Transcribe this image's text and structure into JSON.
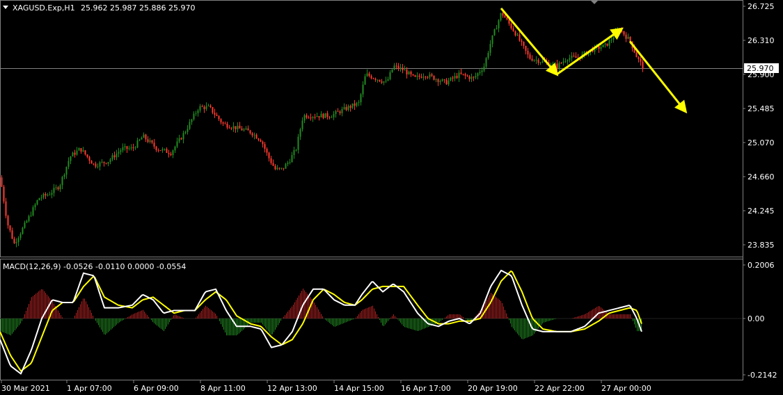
{
  "symbol_header": {
    "menu_icon": "triangle-down-icon",
    "title": "XAGUSD.Exp,H1",
    "ohlc": "25.962 25.987 25.886 25.970"
  },
  "macd_header": "MACD(12,26,9) -0.0526 -0.0110 0.0000 -0.0554",
  "price_axis": {
    "ticks": [
      "26.725",
      "26.310",
      "25.900",
      "25.485",
      "25.070",
      "24.660",
      "24.245",
      "23.835"
    ],
    "current_price": "25.970"
  },
  "macd_axis": {
    "ticks": [
      "0.2006",
      "0.00",
      "-0.2142"
    ]
  },
  "time_axis": {
    "labels": [
      "30 Mar 2021",
      "1 Apr 07:00",
      "6 Apr 09:00",
      "8 Apr 11:00",
      "12 Apr 13:00",
      "14 Apr 15:00",
      "16 Apr 17:00",
      "20 Apr 19:00",
      "22 Apr 22:00",
      "27 Apr 00:00"
    ]
  },
  "colors": {
    "background": "#000000",
    "bull": "#228b22",
    "bear": "#ff3b30",
    "grid_line": "#808080",
    "current_price_bg": "#ffffff",
    "current_price_text": "#000000",
    "macd_line": "#ffffff",
    "signal_line": "#ffff00",
    "histogram_pos": "#b22222",
    "histogram_neg": "#228b22",
    "arrows": "#ffff00",
    "axis_text": "#ffffff"
  },
  "chart_data": {
    "type": "line",
    "description": "XAGUSD H1 candlestick approximation (close path) with MACD(12,26,9) sub-panel",
    "price_ylim": [
      23.7,
      26.8
    ],
    "macd_ylim": [
      -0.23,
      0.22
    ],
    "x_labels": [
      "30 Mar 2021",
      "1 Apr 07:00",
      "6 Apr 09:00",
      "8 Apr 11:00",
      "12 Apr 13:00",
      "14 Apr 15:00",
      "16 Apr 17:00",
      "20 Apr 19:00",
      "22 Apr 22:00",
      "27 Apr 00:00"
    ],
    "price_keypoints": [
      [
        0,
        24.65
      ],
      [
        10,
        24.1
      ],
      [
        20,
        23.85
      ],
      [
        30,
        24.0
      ],
      [
        40,
        24.15
      ],
      [
        55,
        24.4
      ],
      [
        70,
        24.45
      ],
      [
        85,
        24.55
      ],
      [
        100,
        24.9
      ],
      [
        115,
        25.0
      ],
      [
        135,
        24.8
      ],
      [
        155,
        24.85
      ],
      [
        175,
        25.0
      ],
      [
        190,
        25.0
      ],
      [
        205,
        25.15
      ],
      [
        225,
        25.0
      ],
      [
        245,
        24.95
      ],
      [
        265,
        25.2
      ],
      [
        285,
        25.5
      ],
      [
        300,
        25.5
      ],
      [
        320,
        25.3
      ],
      [
        340,
        25.25
      ],
      [
        360,
        25.2
      ],
      [
        375,
        25.1
      ],
      [
        385,
        24.9
      ],
      [
        395,
        24.75
      ],
      [
        405,
        24.75
      ],
      [
        415,
        24.85
      ],
      [
        425,
        25.0
      ],
      [
        435,
        25.4
      ],
      [
        455,
        25.4
      ],
      [
        475,
        25.4
      ],
      [
        500,
        25.5
      ],
      [
        515,
        25.55
      ],
      [
        525,
        25.9
      ],
      [
        540,
        25.85
      ],
      [
        555,
        25.8
      ],
      [
        565,
        26.0
      ],
      [
        580,
        25.95
      ],
      [
        595,
        25.85
      ],
      [
        610,
        25.9
      ],
      [
        625,
        25.85
      ],
      [
        640,
        25.8
      ],
      [
        660,
        25.9
      ],
      [
        680,
        25.85
      ],
      [
        695,
        26.0
      ],
      [
        705,
        26.3
      ],
      [
        720,
        26.65
      ],
      [
        740,
        26.4
      ],
      [
        760,
        26.1
      ],
      [
        780,
        26.05
      ],
      [
        800,
        26.0
      ],
      [
        815,
        26.1
      ],
      [
        830,
        26.1
      ],
      [
        850,
        26.2
      ],
      [
        870,
        26.25
      ],
      [
        890,
        26.45
      ],
      [
        905,
        26.3
      ],
      [
        915,
        26.1
      ],
      [
        925,
        25.97
      ]
    ],
    "arrows": [
      [
        [
          720,
          26.7
        ],
        [
          800,
          25.9
        ]
      ],
      [
        [
          800,
          25.9
        ],
        [
          893,
          26.45
        ]
      ],
      [
        [
          905,
          26.3
        ],
        [
          985,
          25.45
        ]
      ]
    ],
    "macd_keypoints": [
      [
        0,
        -0.08
      ],
      [
        15,
        -0.18
      ],
      [
        30,
        -0.21
      ],
      [
        45,
        -0.12
      ],
      [
        60,
        0.0
      ],
      [
        75,
        0.07
      ],
      [
        90,
        0.06
      ],
      [
        105,
        0.06
      ],
      [
        120,
        0.17
      ],
      [
        135,
        0.16
      ],
      [
        150,
        0.04
      ],
      [
        170,
        0.04
      ],
      [
        190,
        0.05
      ],
      [
        205,
        0.09
      ],
      [
        220,
        0.07
      ],
      [
        235,
        0.02
      ],
      [
        250,
        0.03
      ],
      [
        265,
        0.03
      ],
      [
        280,
        0.03
      ],
      [
        295,
        0.1
      ],
      [
        310,
        0.11
      ],
      [
        325,
        0.03
      ],
      [
        340,
        -0.03
      ],
      [
        360,
        -0.03
      ],
      [
        375,
        -0.04
      ],
      [
        390,
        -0.11
      ],
      [
        405,
        -0.1
      ],
      [
        420,
        -0.05
      ],
      [
        435,
        0.05
      ],
      [
        450,
        0.11
      ],
      [
        465,
        0.11
      ],
      [
        480,
        0.07
      ],
      [
        495,
        0.05
      ],
      [
        510,
        0.05
      ],
      [
        520,
        0.09
      ],
      [
        535,
        0.14
      ],
      [
        550,
        0.1
      ],
      [
        565,
        0.13
      ],
      [
        580,
        0.1
      ],
      [
        600,
        0.02
      ],
      [
        615,
        -0.02
      ],
      [
        630,
        -0.03
      ],
      [
        645,
        -0.01
      ],
      [
        660,
        0.0
      ],
      [
        675,
        -0.02
      ],
      [
        690,
        0.02
      ],
      [
        705,
        0.12
      ],
      [
        720,
        0.18
      ],
      [
        735,
        0.16
      ],
      [
        750,
        0.05
      ],
      [
        765,
        -0.04
      ],
      [
        780,
        -0.05
      ],
      [
        800,
        -0.05
      ],
      [
        820,
        -0.05
      ],
      [
        840,
        -0.03
      ],
      [
        860,
        0.02
      ],
      [
        875,
        0.03
      ],
      [
        890,
        0.04
      ],
      [
        905,
        0.05
      ],
      [
        915,
        0.0
      ],
      [
        922,
        -0.05
      ]
    ],
    "signal_keypoints": [
      [
        0,
        -0.05
      ],
      [
        15,
        -0.14
      ],
      [
        30,
        -0.2
      ],
      [
        45,
        -0.17
      ],
      [
        60,
        -0.07
      ],
      [
        75,
        0.03
      ],
      [
        90,
        0.06
      ],
      [
        105,
        0.06
      ],
      [
        120,
        0.12
      ],
      [
        135,
        0.16
      ],
      [
        150,
        0.08
      ],
      [
        170,
        0.05
      ],
      [
        190,
        0.04
      ],
      [
        205,
        0.07
      ],
      [
        220,
        0.08
      ],
      [
        235,
        0.05
      ],
      [
        250,
        0.02
      ],
      [
        265,
        0.03
      ],
      [
        280,
        0.03
      ],
      [
        295,
        0.07
      ],
      [
        310,
        0.1
      ],
      [
        325,
        0.07
      ],
      [
        340,
        0.01
      ],
      [
        360,
        -0.02
      ],
      [
        375,
        -0.03
      ],
      [
        390,
        -0.07
      ],
      [
        405,
        -0.1
      ],
      [
        420,
        -0.08
      ],
      [
        435,
        -0.02
      ],
      [
        450,
        0.07
      ],
      [
        465,
        0.11
      ],
      [
        480,
        0.09
      ],
      [
        495,
        0.06
      ],
      [
        510,
        0.05
      ],
      [
        520,
        0.07
      ],
      [
        535,
        0.11
      ],
      [
        550,
        0.12
      ],
      [
        565,
        0.12
      ],
      [
        580,
        0.12
      ],
      [
        600,
        0.05
      ],
      [
        615,
        0.0
      ],
      [
        630,
        -0.02
      ],
      [
        645,
        -0.02
      ],
      [
        660,
        -0.01
      ],
      [
        675,
        -0.01
      ],
      [
        690,
        0.0
      ],
      [
        705,
        0.06
      ],
      [
        720,
        0.14
      ],
      [
        735,
        0.18
      ],
      [
        750,
        0.1
      ],
      [
        765,
        0.0
      ],
      [
        780,
        -0.04
      ],
      [
        800,
        -0.05
      ],
      [
        820,
        -0.05
      ],
      [
        840,
        -0.04
      ],
      [
        860,
        -0.01
      ],
      [
        875,
        0.02
      ],
      [
        890,
        0.03
      ],
      [
        905,
        0.04
      ],
      [
        915,
        0.03
      ],
      [
        922,
        -0.02
      ]
    ]
  }
}
